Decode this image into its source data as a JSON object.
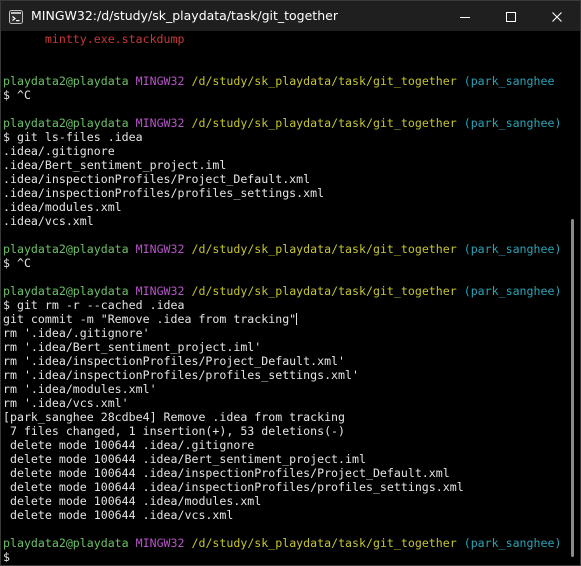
{
  "window": {
    "title": "MINGW32:/d/study/sk_playdata/task/git_together"
  },
  "prompt": {
    "user": "playdata2@playdata",
    "system": "MINGW32",
    "path": "/d/study/sk_playdata/task/git_together",
    "branch": "(park_sanghee)",
    "branch_cut": "(park_sanghee",
    "symbol": "$"
  },
  "terminal": {
    "stackdump_line": "      mintty.exe.stackdump",
    "cmd_ctrl_c": "^C",
    "cmd_ls_files": "git ls-files .idea",
    "ls_files_output": [
      ".idea/.gitignore",
      ".idea/Bert_sentiment_project.iml",
      ".idea/inspectionProfiles/Project_Default.xml",
      ".idea/inspectionProfiles/profiles_settings.xml",
      ".idea/modules.xml",
      ".idea/vcs.xml"
    ],
    "cmd_git_rm": "git rm -r --cached .idea",
    "cmd_git_commit": "git commit -m \"Remove .idea from tracking\"",
    "rm_output": [
      "rm '.idea/.gitignore'",
      "rm '.idea/Bert_sentiment_project.iml'",
      "rm '.idea/inspectionProfiles/Project_Default.xml'",
      "rm '.idea/inspectionProfiles/profiles_settings.xml'",
      "rm '.idea/modules.xml'",
      "rm '.idea/vcs.xml'"
    ],
    "commit_output": [
      "[park_sanghee 28cdbe4] Remove .idea from tracking",
      " 7 files changed, 1 insertion(+), 53 deletions(-)",
      " delete mode 100644 .idea/.gitignore",
      " delete mode 100644 .idea/Bert_sentiment_project.iml",
      " delete mode 100644 .idea/inspectionProfiles/Project_Default.xml",
      " delete mode 100644 .idea/inspectionProfiles/profiles_settings.xml",
      " delete mode 100644 .idea/modules.xml",
      " delete mode 100644 .idea/vcs.xml"
    ]
  },
  "icons": {
    "app": "mintty-terminal-icon",
    "minimize": "minimize-icon",
    "maximize": "maximize-icon",
    "close": "close-icon"
  },
  "colors": {
    "background": "#000000",
    "titlebar": "#1f1f1f",
    "prompt_user": "#6cc067",
    "prompt_system": "#b453c6",
    "prompt_path": "#c5c531",
    "prompt_branch": "#2ba3b6",
    "stackdump": "#c63838",
    "text": "#d9d9d9"
  }
}
